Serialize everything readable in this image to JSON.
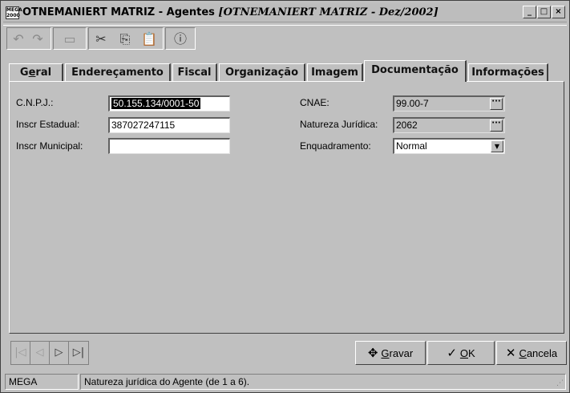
{
  "window": {
    "app_icon_lines": [
      "MEGA",
      "2000"
    ],
    "title": "OTNEMANIERT MATRIZ -  Agentes",
    "title_italic": "[OTNEMANIERT MATRIZ - Dez/2002]",
    "minimize": "_",
    "maximize": "□",
    "close": "×"
  },
  "toolbar": {
    "undo_icon": "↶",
    "redo_icon": "↷",
    "delete_icon": "▭",
    "cut_icon": "✂",
    "copy_icon": "⎘",
    "paste_icon": "📋",
    "info_icon": "ⓘ"
  },
  "tabs": [
    {
      "label_pre": "G",
      "label_u": "e",
      "label_post": "ral"
    },
    {
      "label_pre": "Endereçamento",
      "label_u": "",
      "label_post": ""
    },
    {
      "label_pre": "Fiscal",
      "label_u": "",
      "label_post": ""
    },
    {
      "label_pre": "Organização",
      "label_u": "",
      "label_post": ""
    },
    {
      "label_pre": "Imagem",
      "label_u": "",
      "label_post": ""
    },
    {
      "label_pre": "Documentação",
      "label_u": "",
      "label_post": ""
    },
    {
      "label_pre": "Informações",
      "label_u": "",
      "label_post": ""
    }
  ],
  "form": {
    "cnpj_label": "C.N.P.J.:",
    "cnpj_value": "50.155.134/0001-50",
    "ie_label": "Inscr Estadual:",
    "ie_value": "387027247115",
    "im_label": "Inscr Municipal:",
    "im_value": "",
    "cnae_label": "CNAE:",
    "cnae_value": "99.00-7",
    "natureza_label": "Natureza Jurídica:",
    "natureza_value": "2062",
    "enquadramento_label": "Enquadramento:",
    "enquadramento_value": "Normal",
    "ellipsis": "···",
    "dropdown_arrow": "▼"
  },
  "nav": {
    "first": "|◁",
    "prev": "◁",
    "next": "▷",
    "last": "▷|"
  },
  "actions": {
    "gravar_icon": "✥",
    "gravar_u": "G",
    "gravar_rest": "ravar",
    "ok_icon": "✓",
    "ok_u": "O",
    "ok_rest": "K",
    "cancela_icon": "✕",
    "cancela_u": "C",
    "cancela_rest": "ancela"
  },
  "status": {
    "left": "MEGA",
    "message": "Natureza jurídica do Agente (de 1 a 6).",
    "grip": "⋰"
  }
}
